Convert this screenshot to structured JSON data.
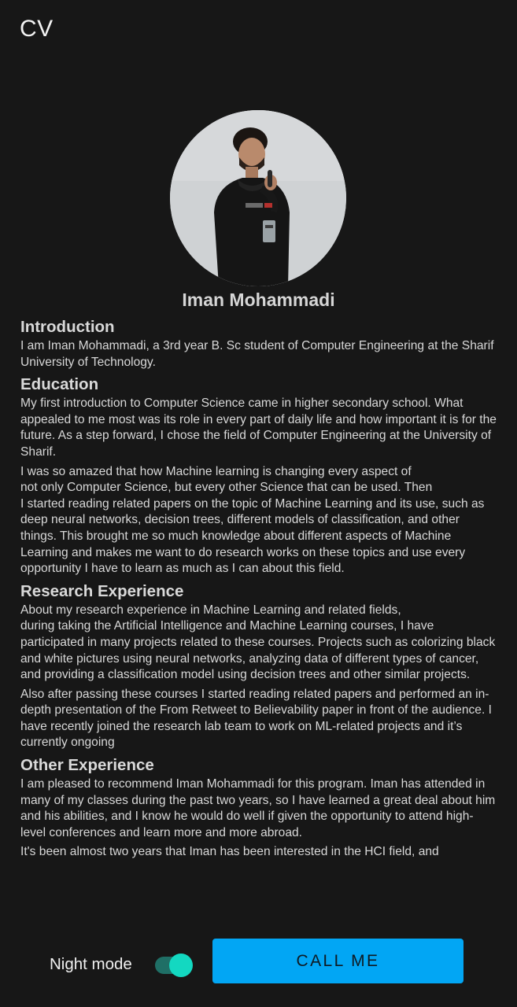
{
  "app_bar": {
    "title": "CV"
  },
  "profile": {
    "name": "Iman Mohammadi",
    "photo_icon": "profile-photo"
  },
  "sections": {
    "introduction": {
      "heading": "Introduction",
      "paragraphs": [
        "I am Iman Mohammadi, a 3rd year B. Sc student of Computer Engineering at the Sharif University of Technology."
      ]
    },
    "education": {
      "heading": "Education",
      "paragraphs": [
        "My first introduction to Computer Science came in higher secondary school. What appealed to me most was its role in every part of daily life and how important it is for the future. As a step forward, I chose the field of Computer Engineering at the University of Sharif.",
        "I was so amazed that how Machine learning is changing every aspect of\nnot only Computer Science, but every other Science that can be used. Then\nI started reading related papers on the topic of Machine Learning and its use, such as deep neural networks, decision trees, different models of classification, and other things. This brought me so much knowledge about different aspects of Machine Learning and makes me want to do research works on these topics and use every opportunity I have to learn as much as I can about this field."
      ]
    },
    "research": {
      "heading": "Research Experience",
      "paragraphs": [
        "About my research experience in Machine Learning and related fields,\nduring taking the Artificial Intelligence and Machine Learning courses, I have participated in many projects related to these courses. Projects such as colorizing black and white pictures using neural networks, analyzing data of different types of cancer, and providing a classification model using decision trees and other similar projects.",
        "Also after passing these courses I started reading related papers and performed an in-depth presentation of the From Retweet to Believability paper in front of the audience. I have recently joined the research lab team to work on ML-related projects and it’s currently ongoing"
      ]
    },
    "other": {
      "heading": "Other Experience",
      "paragraphs": [
        "I am pleased to recommend Iman Mohammadi for this program. Iman has attended in many of my classes during the past two years, so I have learned a great deal about him and his abilities, and I know he would do well if given the opportunity to attend high-level conferences and learn more and more abroad.",
        "It's been almost two years that Iman has been interested in the HCI field, and"
      ]
    }
  },
  "bottom_bar": {
    "night_mode_label": "Night mode",
    "night_mode_on": true,
    "call_button_label": "CALL ME"
  },
  "colors": {
    "background": "#171717",
    "accent_button": "#02a6f4",
    "toggle_thumb": "#13d8c1",
    "toggle_track": "#1f6f66"
  }
}
